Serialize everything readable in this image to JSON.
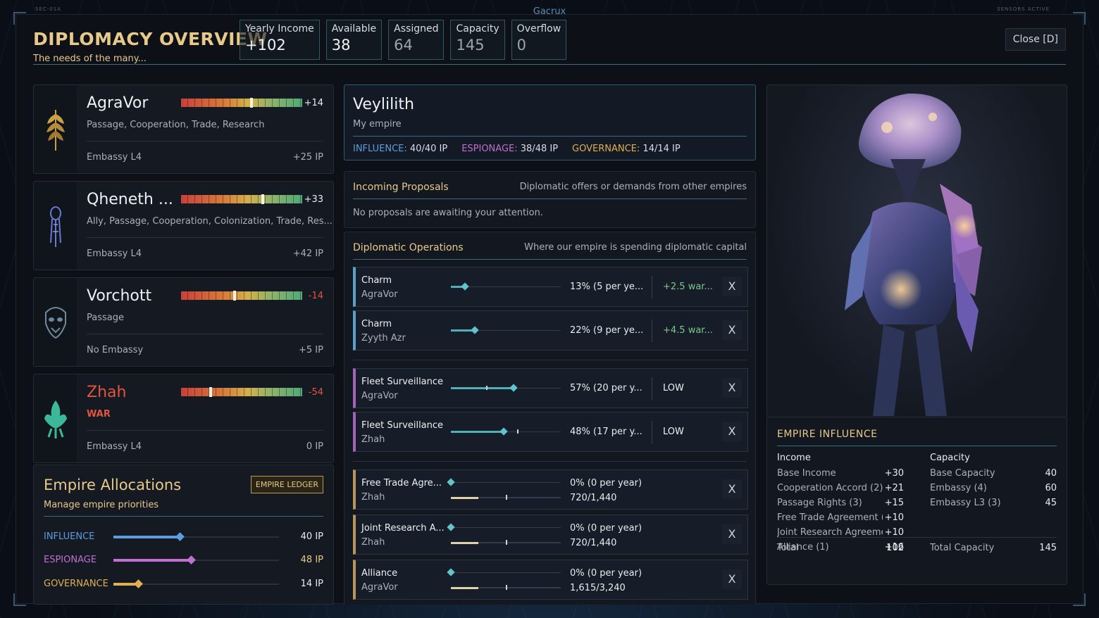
{
  "top_left_label": "SEC-01A",
  "top_center_label": "Gacrux",
  "top_right_label": "SENSORS ACTIVE",
  "header": {
    "title": "DIPLOMACY OVERVIEW",
    "subtitle": "The needs of the many...",
    "close_label": "Close [D]"
  },
  "stats": [
    {
      "label": "Yearly Income",
      "value": "+102"
    },
    {
      "label": "Available",
      "value": "38"
    },
    {
      "label": "Assigned",
      "value": "64"
    },
    {
      "label": "Capacity",
      "value": "145"
    },
    {
      "label": "Overflow",
      "value": "0"
    }
  ],
  "empires": [
    {
      "name": "AgraVor",
      "traits": "Passage, Cooperation, Trade, Research",
      "relation": "+14",
      "relation_fraction": 0.57,
      "embassy": "Embassy L4",
      "ip": "+25 IP",
      "emblem": "wheat-icon",
      "war": false
    },
    {
      "name": "Qheneth ...",
      "traits": "Ally, Passage, Cooperation, Colonization, Trade, Res...",
      "relation": "+33",
      "relation_fraction": 0.665,
      "embassy": "Embassy L4",
      "ip": "+42 IP",
      "emblem": "squid-icon",
      "war": false
    },
    {
      "name": "Vorchott",
      "traits": "Passage",
      "relation": "-14",
      "relation_fraction": 0.43,
      "embassy": "No Embassy",
      "ip": "+5 IP",
      "emblem": "mask-icon",
      "war": false
    },
    {
      "name": "Zhah",
      "traits": "WAR",
      "relation": "-54",
      "relation_fraction": 0.23,
      "embassy": "Embassy L4",
      "ip": "0 IP",
      "emblem": "claw-icon",
      "war": true
    }
  ],
  "allocations": {
    "title": "Empire Allocations",
    "subtitle": "Manage empire priorities",
    "ledger_label": "EMPIRE LEDGER",
    "rows": [
      {
        "label": "INFLUENCE",
        "value": "40 IP",
        "fraction": 0.4,
        "color": "#5a9ee0"
      },
      {
        "label": "ESPIONAGE",
        "value": "48 IP",
        "fraction": 0.47,
        "color": "#c070d0"
      },
      {
        "label": "GOVERNANCE",
        "value": "14 IP",
        "fraction": 0.15,
        "color": "#e0b050"
      }
    ]
  },
  "my_empire": {
    "name": "Veylilith",
    "subtitle": "My empire",
    "stats": [
      {
        "label": "INFLUENCE:",
        "value": "40/40 IP",
        "color": "#5a9ee0"
      },
      {
        "label": "ESPIONAGE:",
        "value": "38/48 IP",
        "color": "#c070d0"
      },
      {
        "label": "GOVERNANCE:",
        "value": "14/14 IP",
        "color": "#e0b050"
      }
    ]
  },
  "proposals": {
    "title": "Incoming Proposals",
    "description": "Diplomatic offers or demands from other empires",
    "empty": "No proposals are awaiting your attention."
  },
  "operations": {
    "title": "Diplomatic Operations",
    "description": "Where our empire is spending diplomatic capital",
    "items": [
      {
        "name": "Charm",
        "target": "AgraVor",
        "pct": "13% (5 per ye...",
        "effect": "+2.5 war...",
        "fraction": 0.13,
        "accent": "blue"
      },
      {
        "name": "Charm",
        "target": "Zyyth Azr",
        "pct": "22% (9 per ye...",
        "effect": "+4.5 war...",
        "fraction": 0.22,
        "accent": "blue"
      },
      {
        "name": "Fleet Surveillance",
        "target": "AgraVor",
        "pct": "57% (20 per y...",
        "effect": "LOW",
        "fraction": 0.57,
        "tick": 0.32,
        "accent": "purple"
      },
      {
        "name": "Fleet Surveillance",
        "target": "Zhah",
        "pct": "48% (17 per y...",
        "effect": "LOW",
        "fraction": 0.48,
        "tick": 0.6,
        "accent": "purple"
      },
      {
        "name": "Free Trade Agre...",
        "target": "Zhah",
        "pct": "0% (0 per year)",
        "progress": "720/1,440",
        "progress_fraction": 0.25,
        "accent": "gold"
      },
      {
        "name": "Joint Research A...",
        "target": "Zhah",
        "pct": "0% (0 per year)",
        "progress": "720/1,440",
        "progress_fraction": 0.25,
        "accent": "gold"
      },
      {
        "name": "Alliance",
        "target": "AgraVor",
        "pct": "0% (0 per year)",
        "progress": "1,615/3,240",
        "progress_fraction": 0.25,
        "accent": "gold"
      }
    ],
    "remove_label": "X"
  },
  "influence": {
    "title": "EMPIRE INFLUENCE",
    "income_head": "Income",
    "capacity_head": "Capacity",
    "income": [
      {
        "label": "Base Income",
        "value": "+30"
      },
      {
        "label": "Cooperation Accord (2)",
        "value": "+21"
      },
      {
        "label": "Passage Rights (3)",
        "value": "+15"
      },
      {
        "label": "Free Trade Agreement (",
        "value": "+10"
      },
      {
        "label": "Joint Research Agreeme",
        "value": "+10"
      },
      {
        "label": "Alliance (1)",
        "value": "+16"
      }
    ],
    "capacity": [
      {
        "label": "Base Capacity",
        "value": "40"
      },
      {
        "label": "Embassy (4)",
        "value": "60"
      },
      {
        "label": "Embassy L3 (3)",
        "value": "45"
      }
    ],
    "total_label": "Total",
    "total_value": "102",
    "total_capacity_label": "Total Capacity",
    "total_capacity_value": "145"
  }
}
